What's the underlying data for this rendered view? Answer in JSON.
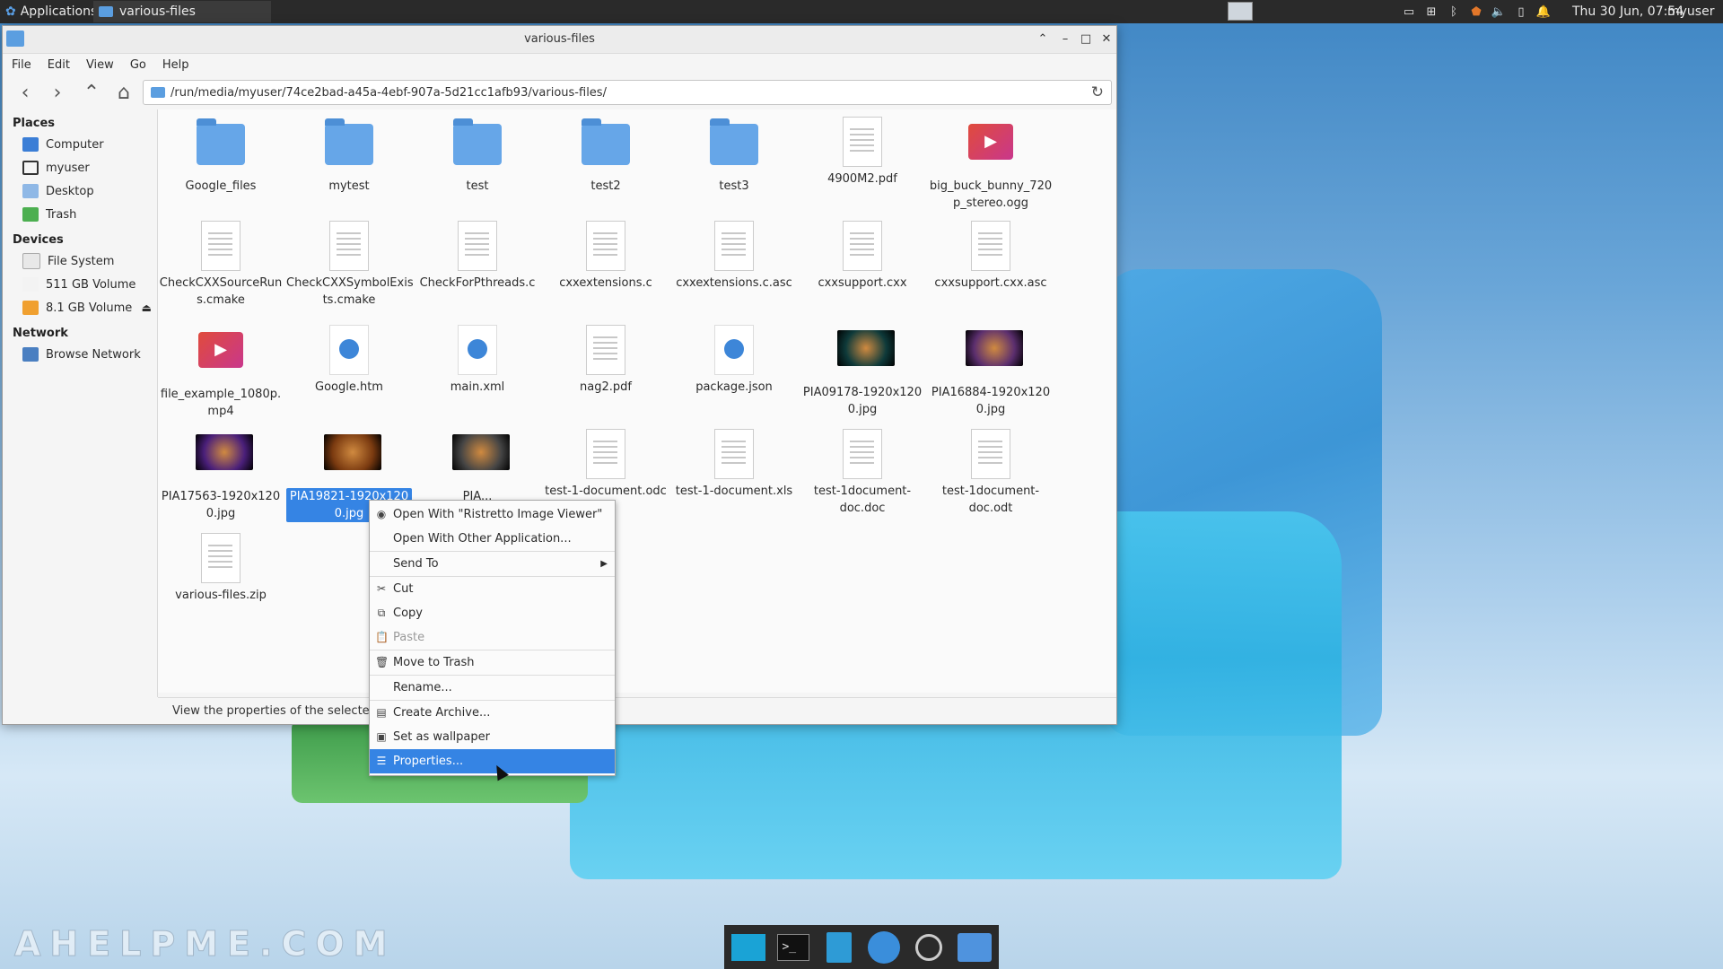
{
  "top_panel": {
    "applications_label": "Applications",
    "task_title": "various-files",
    "clock": "Thu 30 Jun, 07:54",
    "user": "myuser"
  },
  "window": {
    "title": "various-files",
    "menu": [
      "File",
      "Edit",
      "View",
      "Go",
      "Help"
    ],
    "location": "/run/media/myuser/74ce2bad-a45a-4ebf-907a-5d21cc1afb93/various-files/"
  },
  "sidebar": {
    "places_header": "Places",
    "places": [
      "Computer",
      "myuser",
      "Desktop",
      "Trash"
    ],
    "devices_header": "Devices",
    "devices": [
      "File System",
      "511 GB Volume",
      "8.1 GB Volume"
    ],
    "network_header": "Network",
    "network": [
      "Browse Network"
    ]
  },
  "files": [
    {
      "name": "Google_files",
      "kind": "folder"
    },
    {
      "name": "mytest",
      "kind": "folder"
    },
    {
      "name": "test",
      "kind": "folder"
    },
    {
      "name": "test2",
      "kind": "folder"
    },
    {
      "name": "test3",
      "kind": "folder"
    },
    {
      "name": "4900M2.pdf",
      "kind": "doc"
    },
    {
      "name": "big_buck_bunny_720\np_stereo.ogg",
      "kind": "video"
    },
    {
      "name": "CheckCXXSourceRun\ns.cmake",
      "kind": "doc"
    },
    {
      "name": "CheckCXXSymbolExis\nts.cmake",
      "kind": "doc"
    },
    {
      "name": "CheckForPthreads.c",
      "kind": "doc"
    },
    {
      "name": "cxxextensions.c",
      "kind": "doc"
    },
    {
      "name": "cxxextensions.c.asc",
      "kind": "doc"
    },
    {
      "name": "cxxsupport.cxx",
      "kind": "doc"
    },
    {
      "name": "cxxsupport.cxx.asc",
      "kind": "doc"
    },
    {
      "name": "file_example_1080p.\nmp4",
      "kind": "video"
    },
    {
      "name": "Google.htm",
      "kind": "web"
    },
    {
      "name": "main.xml",
      "kind": "web"
    },
    {
      "name": "nag2.pdf",
      "kind": "doc"
    },
    {
      "name": "package.json",
      "kind": "web"
    },
    {
      "name": "PIA09178-1920x120\n0.jpg",
      "kind": "image",
      "color": "#0e3a3a"
    },
    {
      "name": "PIA16884-1920x120\n0.jpg",
      "kind": "image",
      "color": "#5b2e6e"
    },
    {
      "name": "PIA17563-1920x120\n0.jpg",
      "kind": "image",
      "color": "#4a1f7a"
    },
    {
      "name": "PIA19821-1920x120\n0.jpg",
      "kind": "image",
      "color": "#7a3a10",
      "selected": true
    },
    {
      "name": "PIA...",
      "kind": "image",
      "color": "#444444"
    },
    {
      "name": "test-1-document.odc",
      "kind": "doc"
    },
    {
      "name": "test-1-document.xls",
      "kind": "doc"
    },
    {
      "name": "test-1document-\ndoc.doc",
      "kind": "doc"
    },
    {
      "name": "test-1document-\ndoc.odt",
      "kind": "doc"
    },
    {
      "name": "various-files.zip",
      "kind": "doc"
    }
  ],
  "statusbar": "View the properties of the selected file",
  "context_menu": [
    {
      "label": "Open With \"Ristretto Image Viewer\"",
      "icon": "image-viewer-icon"
    },
    {
      "label": "Open With Other Application...",
      "icon": ""
    },
    {
      "label": "Send To",
      "icon": "",
      "submenu": true
    },
    {
      "label": "Cut",
      "icon": "scissors-icon"
    },
    {
      "label": "Copy",
      "icon": "copy-icon"
    },
    {
      "label": "Paste",
      "icon": "paste-icon",
      "disabled": true
    },
    {
      "label": "Move to Trash",
      "icon": "trash-icon"
    },
    {
      "label": "Rename...",
      "icon": ""
    },
    {
      "label": "Create Archive...",
      "icon": "archive-icon"
    },
    {
      "label": "Set as wallpaper",
      "icon": "wallpaper-icon"
    },
    {
      "label": "Properties...",
      "icon": "properties-icon",
      "active": true
    }
  ],
  "watermark": "AHELPME.COM"
}
